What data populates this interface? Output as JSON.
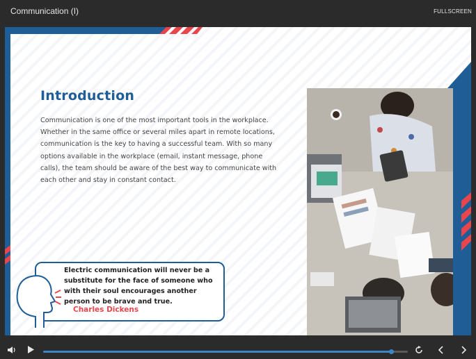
{
  "window": {
    "title": "Communication (I)",
    "fullscreen_label": "FULLSCREEN"
  },
  "slide": {
    "heading": "Introduction",
    "body": "Communication is one of the most important tools in the workplace. Whether in the same office or several miles apart in remote locations, communication is the key to having a successful team. With so many options available in the workplace (email, instant message, phone calls), the team should be aware of the best way to communicate with each other and stay in constant contact.",
    "quote": "Electric communication will never be a substitute for the face of someone who with their soul encourages another person to be brave and true.",
    "quote_author": "Charles Dickens",
    "colors": {
      "accent_blue": "#1f5d96",
      "accent_red": "#e8454d"
    }
  },
  "player": {
    "progress": 0.955,
    "icons": [
      "volume-icon",
      "play-icon",
      "replay-icon",
      "previous-icon",
      "next-icon"
    ]
  }
}
